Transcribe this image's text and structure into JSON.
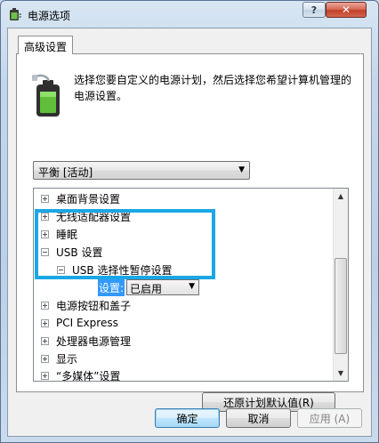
{
  "window": {
    "title": "电源选项",
    "help_label": "?",
    "close_label": "✕"
  },
  "tabs": [
    {
      "label": "高级设置"
    }
  ],
  "main": {
    "description": "选择您要自定义的电源计划，然后选择您希望计算机管理的电源设置。",
    "plan_select": {
      "value": "平衡 [活动]"
    }
  },
  "tree": {
    "items": [
      {
        "label": "桌面背景设置",
        "state": "collapsed"
      },
      {
        "label": "无线适配器设置",
        "state": "collapsed"
      },
      {
        "label": "睡眠",
        "state": "collapsed"
      },
      {
        "label": "USB 设置",
        "state": "expanded"
      },
      {
        "label": "USB 选择性暂停设置",
        "state": "expanded"
      },
      {
        "label": "电源按钮和盖子",
        "state": "collapsed"
      },
      {
        "label": "PCI Express",
        "state": "collapsed"
      },
      {
        "label": "处理器电源管理",
        "state": "collapsed"
      },
      {
        "label": "显示",
        "state": "collapsed"
      },
      {
        "label": "“多媒体”设置",
        "state": "collapsed"
      }
    ],
    "setting": {
      "label": "设置:",
      "value": "已启用"
    }
  },
  "buttons": {
    "restore_defaults": "还原计划默认值(R)",
    "ok": "确定",
    "cancel": "取消",
    "apply": "应用 (A)"
  },
  "colors": {
    "selection": "#3399ff",
    "annotation_box": "#1aa7e6"
  },
  "icons": {
    "app": "power-options-icon",
    "battery": "battery-plug-icon"
  }
}
